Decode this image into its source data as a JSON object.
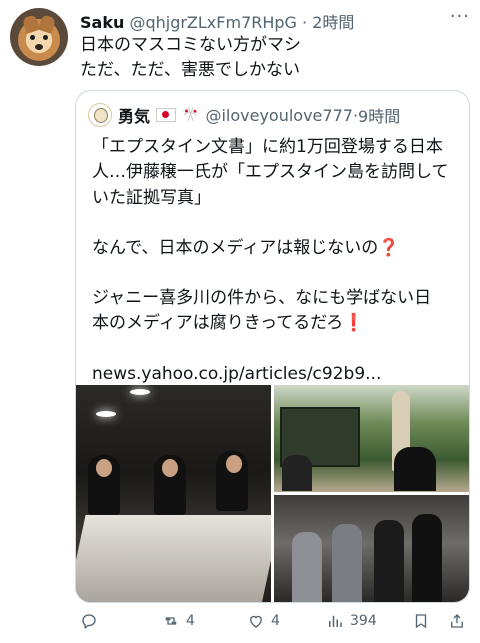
{
  "tweet": {
    "author_name": "Saku",
    "author_handle": "@qhjgrZLxFm7RHpG",
    "separator": "·",
    "time": "2時間",
    "more": "···",
    "text_line1": "日本のマスコミない方がマシ",
    "text_line2": "ただ、ただ、害悪でしかない"
  },
  "quote": {
    "author_name": "勇気",
    "author_handle": "@iloveyoulove777",
    "separator": "·",
    "time": "9時間",
    "lines": [
      "「エプスタイン文書」に約1万回登場する日本",
      "人…伊藤穣一氏が「エプスタイン島を訪問して",
      "いた証拠写真」"
    ],
    "line4": "なんで、日本のメディアは報じないの",
    "line4_mark": "❓",
    "line5": "ジャニー喜多川の件から、なにも学ばない日",
    "line6": "本のメディアは腐りきってるだろ",
    "line6_mark": "❗",
    "link": "news.yahoo.co.jp/articles/c92b9..."
  },
  "actions": {
    "reply_count": "",
    "retweet_count": "4",
    "like_count": "4",
    "views_count": "394"
  }
}
